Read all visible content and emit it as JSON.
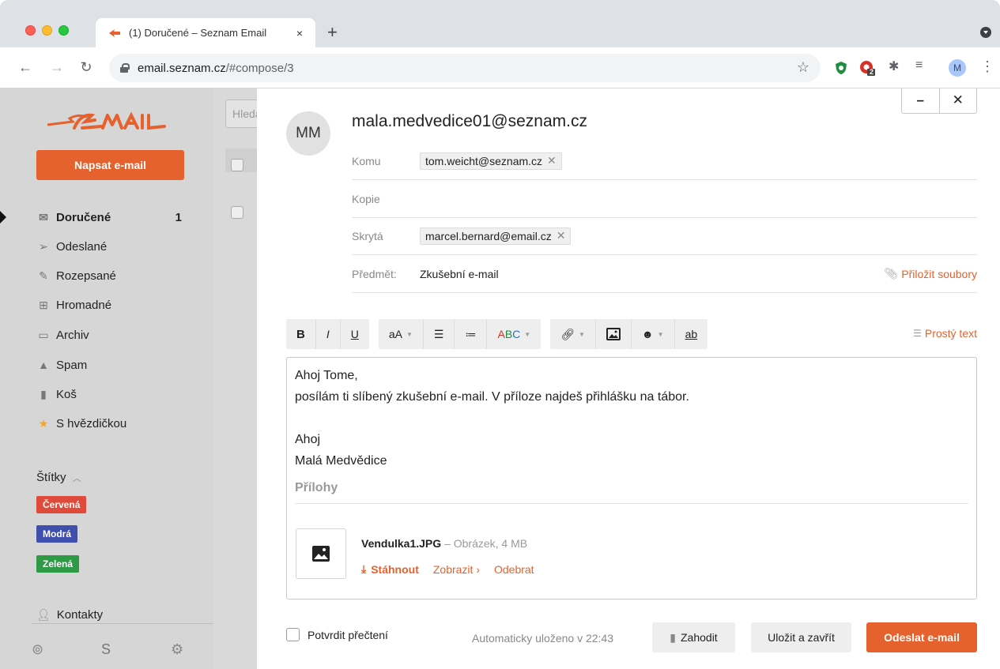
{
  "browser": {
    "tab_title": "(1) Doručené – Seznam Email",
    "tab_close": "×",
    "new_tab": "+",
    "url_host": "email.seznam.cz",
    "url_path": "/#compose/3",
    "profile_initial": "M",
    "extension_badge": "2"
  },
  "sidebar": {
    "compose_label": "Napsat e-mail",
    "items": [
      {
        "label": "Doručené",
        "count": "1",
        "icon": "inbox-icon"
      },
      {
        "label": "Odeslané",
        "icon": "send-icon"
      },
      {
        "label": "Rozepsané",
        "icon": "draft-icon"
      },
      {
        "label": "Hromadné",
        "icon": "cart-icon"
      },
      {
        "label": "Archiv",
        "icon": "archive-icon"
      },
      {
        "label": "Spam",
        "icon": "warning-icon"
      },
      {
        "label": "Koš",
        "icon": "trash-icon"
      },
      {
        "label": "S hvězdičkou",
        "icon": "star-icon"
      }
    ],
    "labels_heading": "Štítky",
    "labels": [
      {
        "name": "Červená",
        "color": "#e04a3b"
      },
      {
        "name": "Modrá",
        "color": "#3f4fae"
      },
      {
        "name": "Zelená",
        "color": "#2f9a46"
      }
    ],
    "contacts": "Kontakty"
  },
  "list": {
    "search_placeholder": "Hledat"
  },
  "compose": {
    "from_initials": "MM",
    "from_address": "mala.medvedice01@seznam.cz",
    "to_label": "Komu",
    "to_recipients": [
      "tom.weicht@seznam.cz"
    ],
    "cc_label": "Kopie",
    "bcc_label": "Skrytá",
    "bcc_recipients": [
      "marcel.bernard@email.cz"
    ],
    "subject_label": "Předmět:",
    "subject": "Zkušební e-mail",
    "attach_files": "Přiložit soubory",
    "toolbar": {
      "bold": "B",
      "italic": "I",
      "underline": "U",
      "font_size": "aA",
      "spellcheck_a": "A",
      "spellcheck_b": "B",
      "spellcheck_c": "C",
      "strike": "ab",
      "plain_text": "Prostý text"
    },
    "body_lines": [
      "Ahoj Tome,",
      "posílám ti slíbený zkušební e-mail. V příloze najdeš přihlášku na tábor.",
      "",
      "Ahoj",
      "Malá Medvědice"
    ],
    "attachments_heading": "Přílohy",
    "attachment": {
      "name": "Vendulka1.JPG",
      "meta": " – Obrázek, 4 MB",
      "download": "Stáhnout",
      "view": "Zobrazit ›",
      "remove": "Odebrat"
    },
    "confirm_read": "Potvrdit přečtení",
    "autosave": "Automaticky uloženo v 22:43",
    "discard": "Zahodit",
    "save_close": "Uložit a zavřít",
    "send": "Odeslat e-mail",
    "accent_color": "#e5612d"
  }
}
